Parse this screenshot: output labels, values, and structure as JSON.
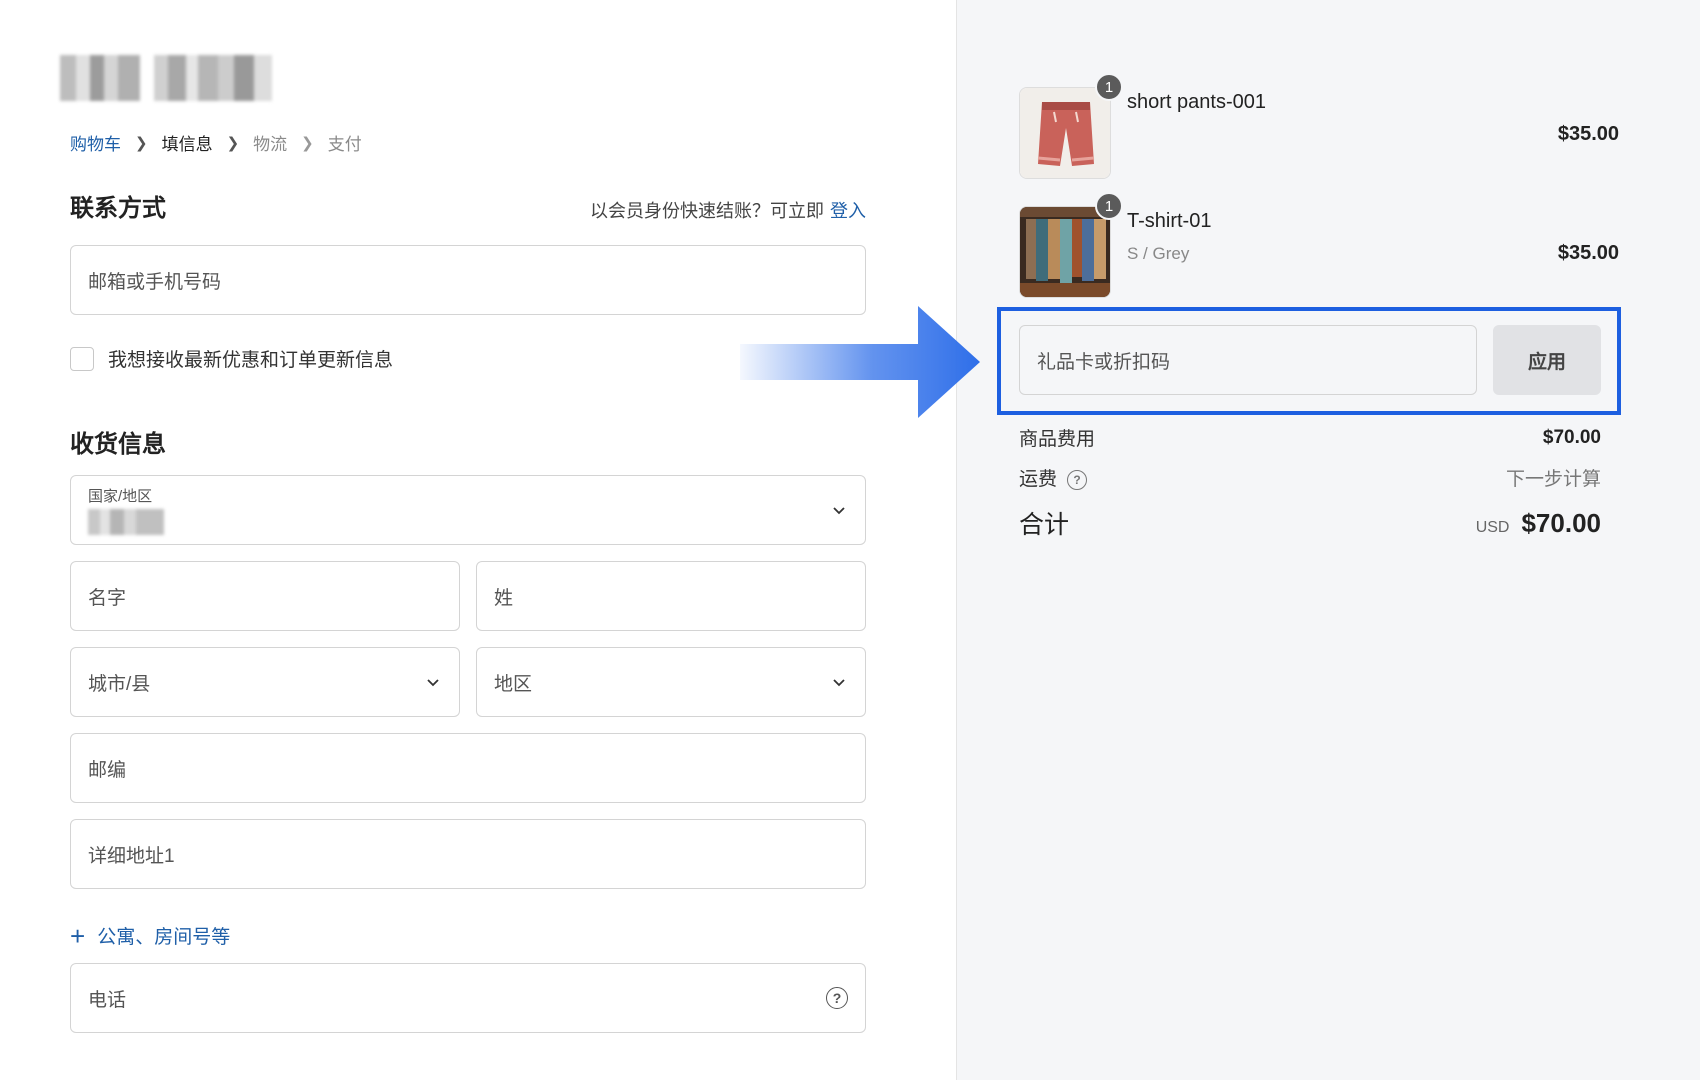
{
  "breadcrumb": {
    "items": [
      "购物车",
      "填信息",
      "物流",
      "支付"
    ]
  },
  "contact": {
    "title": "联系方式",
    "login_hint": "以会员身份快速结账？可立即",
    "login_link": "登入",
    "email_placeholder": "邮箱或手机号码",
    "newsletter_label": "我想接收最新优惠和订单更新信息"
  },
  "shipping": {
    "title": "收货信息",
    "country_label": "国家/地区",
    "first_name": "名字",
    "last_name": "姓",
    "city": "城市/县",
    "region": "地区",
    "postal": "邮编",
    "address1": "详细地址1",
    "add_apartment": "公寓、房间号等",
    "phone": "电话"
  },
  "cart": {
    "items": [
      {
        "quantity": "1",
        "name": "short pants-001",
        "variant": "",
        "price": "$35.00"
      },
      {
        "quantity": "1",
        "name": "T-shirt-01",
        "variant": "S / Grey",
        "price": "$35.00"
      }
    ],
    "discount_placeholder": "礼品卡或折扣码",
    "apply_label": "应用",
    "subtotal_label": "商品费用",
    "subtotal_value": "$70.00",
    "shipping_label": "运费",
    "shipping_value": "下一步计算",
    "total_label": "合计",
    "currency": "USD",
    "total_value": "$70.00"
  },
  "colors": {
    "link": "#1f5fa8",
    "highlight": "#1d5fe0",
    "arrow": "#2f6fe9"
  }
}
